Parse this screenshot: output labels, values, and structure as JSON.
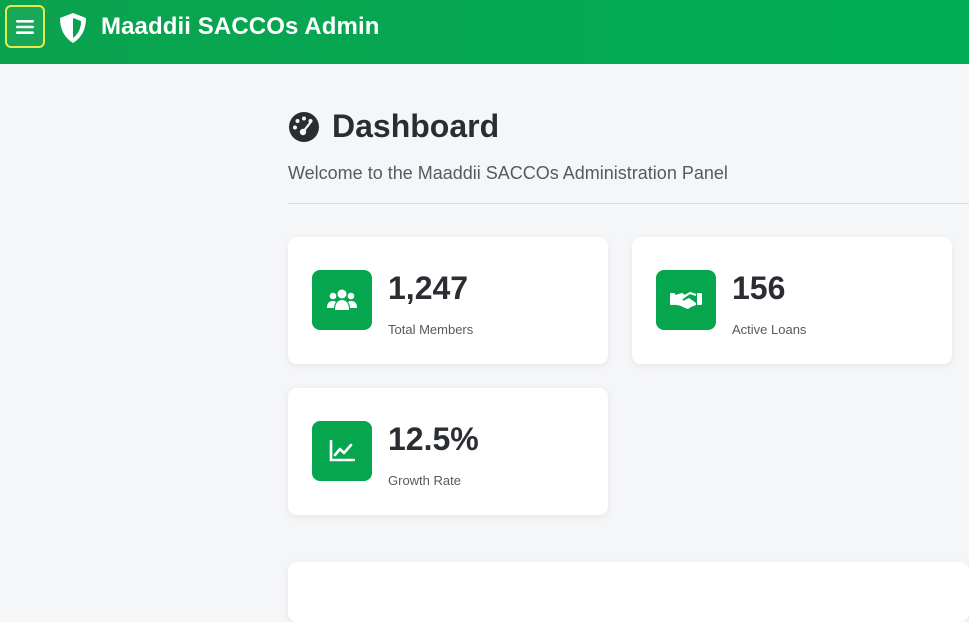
{
  "header": {
    "title": "Maaddii SACCOs Admin",
    "menu_icon": "hamburger-menu-icon",
    "brand_icon": "shield-icon",
    "background_color": "#00ad55",
    "focus_color": "#e4ec4a"
  },
  "page": {
    "title": "Dashboard",
    "title_icon": "dashboard-gauge-icon",
    "subtitle": "Welcome to the Maaddii SACCOs Administration Panel"
  },
  "stats": [
    {
      "value": "1,247",
      "label": "Total Members",
      "icon": "users-icon"
    },
    {
      "value": "156",
      "label": "Active Loans",
      "icon": "handshake-icon"
    },
    {
      "value": "12.5%",
      "label": "Growth Rate",
      "icon": "chart-line-icon"
    }
  ],
  "colors": {
    "accent": "#06a64f",
    "card_bg": "#ffffff",
    "page_bg": "#f5f6f8"
  }
}
